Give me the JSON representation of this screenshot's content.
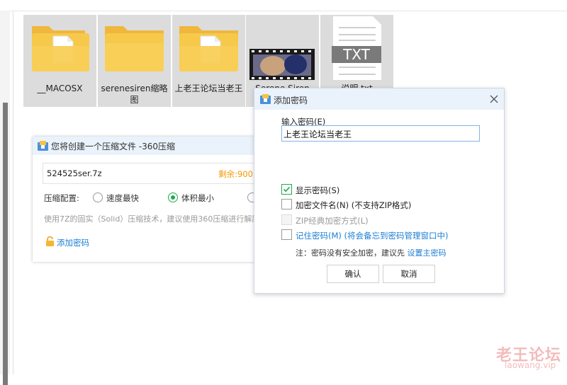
{
  "files": [
    {
      "name": "__MACOSX",
      "type": "folder-doc"
    },
    {
      "name": "serenesiren缩略图",
      "type": "folder"
    },
    {
      "name": "上老王论坛当老王",
      "type": "folder-doc"
    },
    {
      "name": "Serene Siren",
      "type": "video"
    },
    {
      "name": "说明.txt",
      "type": "txt",
      "thumb_label": "TXT"
    }
  ],
  "compress_panel": {
    "title": "您将创建一个压缩文件 -360压缩",
    "archive_name": "524525ser.7z",
    "remaining": "剩余:900",
    "config_label": "压缩配置:",
    "options": [
      "速度最快",
      "体积最小"
    ],
    "selected_option": "体积最小",
    "hint": "使用7Z的固实（Solid）压缩技术，建议使用360压缩进行解压",
    "add_password": "添加密码"
  },
  "password_dialog": {
    "title": "添加密码",
    "input_label": "输入密码(E)",
    "password_value": "上老王论坛当老王",
    "show_password": "显示密码(S)",
    "show_password_checked": true,
    "encrypt_filenames": "加密文件名(N) (不支持ZIP格式)",
    "zip_classic": "ZIP经典加密方式(L)",
    "remember_password": "记住密码(M) (将会备忘到密码管理窗口中)",
    "note_prefix": "注：密码没有安全加密，建议先 ",
    "note_link": "设置主密码",
    "ok": "确认",
    "cancel": "取消"
  },
  "watermark": {
    "cn": "老王论坛",
    "en": "laowang.vip"
  },
  "colors": {
    "accent_green": "#22a94f",
    "link_blue": "#1a7fd4",
    "folder_yellow": "#f7c94b",
    "remaining_orange": "#f39800"
  }
}
